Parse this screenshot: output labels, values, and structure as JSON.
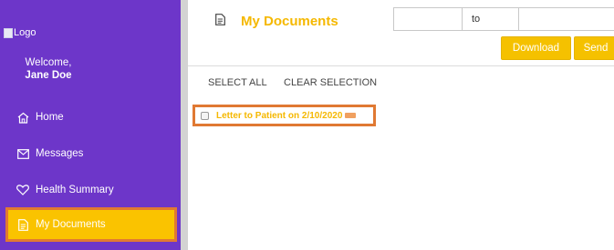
{
  "sidebar": {
    "logo_alt": "Logo",
    "welcome": "Welcome,",
    "user_name": "Jane Doe",
    "items": [
      {
        "label": "Home",
        "icon": "home-icon"
      },
      {
        "label": "Messages",
        "icon": "envelope-icon"
      },
      {
        "label": "Health Summary",
        "icon": "heart-icon"
      },
      {
        "label": "My Documents",
        "icon": "document-icon",
        "active": true
      }
    ]
  },
  "main": {
    "title": "My Documents",
    "date_range": {
      "separator": "to",
      "from_value": "",
      "to_value": ""
    },
    "buttons": {
      "download": "Download",
      "send": "Send"
    },
    "select_all": "SELECT ALL",
    "clear_selection": "CLEAR SELECTION",
    "documents": [
      {
        "title": "Letter to Patient on 2/10/2020",
        "checked": false,
        "new_badge": true
      }
    ]
  },
  "colors": {
    "sidebar_bg": "#6d36c9",
    "accent": "#f5c100",
    "highlight_border": "#e07933"
  }
}
